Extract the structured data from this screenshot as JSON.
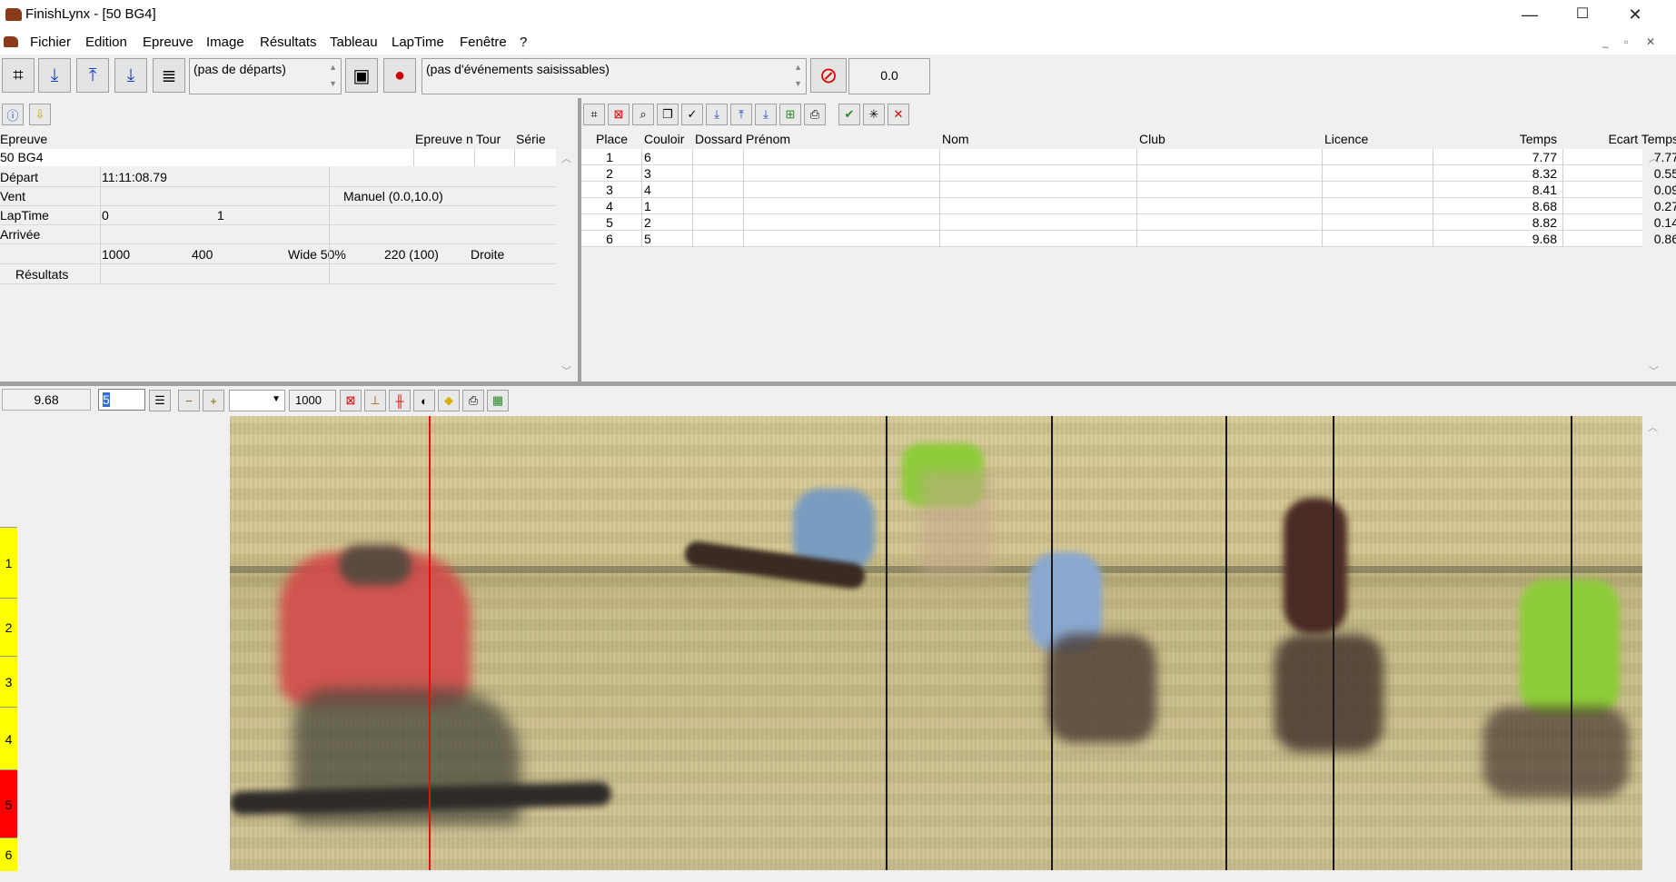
{
  "window": {
    "title": "FinishLynx - [50 BG4]",
    "minimize": "—",
    "maximize": "☐",
    "close": "✕"
  },
  "menu": [
    "Fichier",
    "Edition",
    "Epreuve",
    "Image",
    "Résultats",
    "Tableau",
    "LapTime",
    "Fenêtre",
    "?"
  ],
  "mdi": {
    "min": "_",
    "restore": "▫",
    "close": "✕"
  },
  "toolbar": {
    "starts_combo": "(pas de départs)",
    "events_combo": "(pas d'événements saisissables)",
    "time_display": "0.0"
  },
  "event_panel": {
    "headers": {
      "epreuve": "Epreuve",
      "epreuve_n": "Epreuve n",
      "tour": "Tour",
      "serie": "Série"
    },
    "event_name": "50 BG4",
    "depart_label": "Départ",
    "depart_value": "11:11:08.79",
    "vent_label": "Vent",
    "vent_value": "Manuel (0.0,10.0)",
    "laptime_label": "LapTime",
    "laptime_v1": "0",
    "laptime_v2": "1",
    "arrivee_label": "Arrivée",
    "dist_a": "1000",
    "dist_b": "400",
    "wide": "Wide 50%",
    "size": "220  (100)",
    "direction": "Droite",
    "resultats_label": "Résultats"
  },
  "results": {
    "headers": {
      "place": "Place",
      "couloir": "Couloir",
      "dossard": "Dossard",
      "prenom": "Prénom",
      "nom": "Nom",
      "club": "Club",
      "licence": "Licence",
      "temps": "Temps",
      "ecart": "Ecart Temps"
    },
    "rows": [
      {
        "place": "1",
        "couloir": "6",
        "temps": "7.77",
        "ecart": "7.77"
      },
      {
        "place": "2",
        "couloir": "3",
        "temps": "8.32",
        "ecart": "0.55"
      },
      {
        "place": "3",
        "couloir": "4",
        "temps": "8.41",
        "ecart": "0.09"
      },
      {
        "place": "4",
        "couloir": "1",
        "temps": "8.68",
        "ecart": "0.27"
      },
      {
        "place": "5",
        "couloir": "2",
        "temps": "8.82",
        "ecart": "0.14"
      },
      {
        "place": "6",
        "couloir": "5",
        "temps": "9.68",
        "ecart": "0.86"
      }
    ]
  },
  "image_toolbar": {
    "time": "9.68",
    "zoom_input": "5",
    "density": "1000"
  },
  "lanes": [
    {
      "label": "1",
      "color": "#ffff00"
    },
    {
      "label": "2",
      "color": "#ffff00"
    },
    {
      "label": "3",
      "color": "#ffff00"
    },
    {
      "label": "4",
      "color": "#ffff00"
    },
    {
      "label": "5",
      "color": "#ff0000"
    },
    {
      "label": "6",
      "color": "#ffff00"
    }
  ]
}
